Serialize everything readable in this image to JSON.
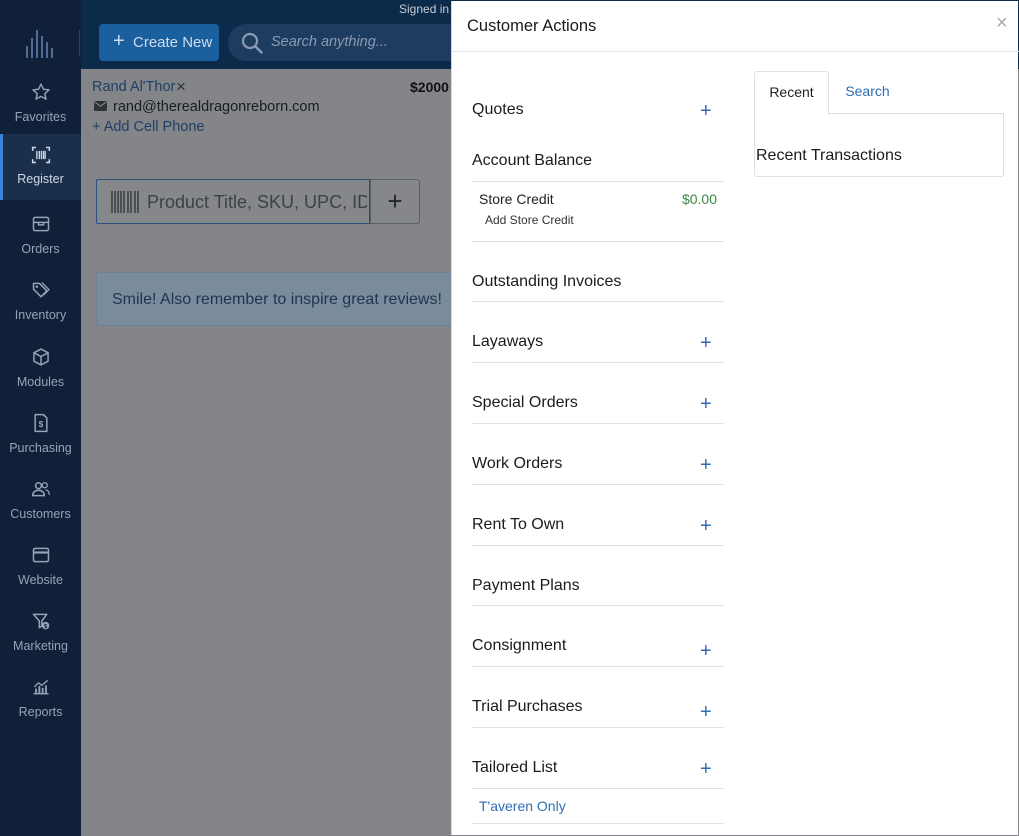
{
  "header": {
    "signed_in_text": "Signed in",
    "create_label": "Create New",
    "search_placeholder": "Search anything..."
  },
  "sidebar": {
    "items": [
      {
        "label": "Favorites",
        "icon": "star-icon"
      },
      {
        "label": "Register",
        "icon": "barcode-scan-icon",
        "active": true
      },
      {
        "label": "Orders",
        "icon": "box-icon"
      },
      {
        "label": "Inventory",
        "icon": "tags-icon"
      },
      {
        "label": "Modules",
        "icon": "cube-icon"
      },
      {
        "label": "Purchasing",
        "icon": "invoice-dollar-icon"
      },
      {
        "label": "Customers",
        "icon": "users-icon"
      },
      {
        "label": "Website",
        "icon": "browser-window-icon"
      },
      {
        "label": "Marketing",
        "icon": "funnel-dollar-icon"
      },
      {
        "label": "Reports",
        "icon": "chart-icon"
      }
    ]
  },
  "register": {
    "customer_name": "Rand Al'Thor",
    "remove_symbol": "×",
    "balance_amount": "$2000",
    "email": "rand@therealdragonreborn.com",
    "add_cell_phone": "+ Add Cell Phone",
    "product_placeholder": "Product Title, SKU, UPC, ID, A",
    "add_symbol": "+",
    "tip": "Smile! Also remember to inspire great reviews!"
  },
  "panel": {
    "title": "Customer Actions",
    "close": "×",
    "plus": "+",
    "sections": {
      "quotes": "Quotes",
      "account_balance": "Account Balance",
      "outstanding_invoices": "Outstanding Invoices",
      "layaways": "Layaways",
      "special_orders": "Special Orders",
      "work_orders": "Work Orders",
      "rent_to_own": "Rent To Own",
      "payment_plans": "Payment Plans",
      "consignment": "Consignment",
      "trial_purchases": "Trial Purchases",
      "tailored_list": "Tailored List"
    },
    "store_credit": {
      "label": "Store Credit",
      "value": "$0.00",
      "add_label": "Add Store Credit"
    },
    "tailored_item": "T'averen Only",
    "tabs": {
      "recent": "Recent",
      "search": "Search"
    },
    "recent_heading": "Recent Transactions"
  },
  "colors": {
    "accent": "#2f6db3",
    "credit_value": "#3b8a3f",
    "sidebar_bg": "#0f2038",
    "topbar_bg": "#0c2a4a"
  }
}
